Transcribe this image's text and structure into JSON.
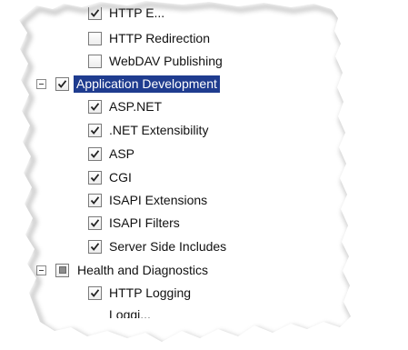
{
  "tree": {
    "items": [
      {
        "label": "HTTP E...",
        "checked": true,
        "partial": false,
        "expander": false,
        "selected": false
      },
      {
        "label": "HTTP Redirection",
        "checked": false,
        "partial": false,
        "expander": false,
        "selected": false
      },
      {
        "label": "WebDAV Publishing",
        "checked": false,
        "partial": false,
        "expander": false,
        "selected": false
      },
      {
        "label": "Application Development",
        "checked": true,
        "partial": false,
        "expander": true,
        "selected": true
      },
      {
        "label": "ASP.NET",
        "checked": true,
        "partial": false,
        "expander": false,
        "selected": false
      },
      {
        "label": ".NET Extensibility",
        "checked": true,
        "partial": false,
        "expander": false,
        "selected": false
      },
      {
        "label": "ASP",
        "checked": true,
        "partial": false,
        "expander": false,
        "selected": false
      },
      {
        "label": "CGI",
        "checked": true,
        "partial": false,
        "expander": false,
        "selected": false
      },
      {
        "label": "ISAPI Extensions",
        "checked": true,
        "partial": false,
        "expander": false,
        "selected": false
      },
      {
        "label": "ISAPI Filters",
        "checked": true,
        "partial": false,
        "expander": false,
        "selected": false
      },
      {
        "label": "Server Side Includes",
        "checked": true,
        "partial": false,
        "expander": false,
        "selected": false
      },
      {
        "label": "Health and Diagnostics",
        "checked": false,
        "partial": true,
        "expander": true,
        "selected": false
      },
      {
        "label": "HTTP Logging",
        "checked": true,
        "partial": false,
        "expander": false,
        "selected": false
      },
      {
        "label": "Loggi...",
        "checked": false,
        "partial": false,
        "expander": false,
        "selected": false
      }
    ]
  }
}
